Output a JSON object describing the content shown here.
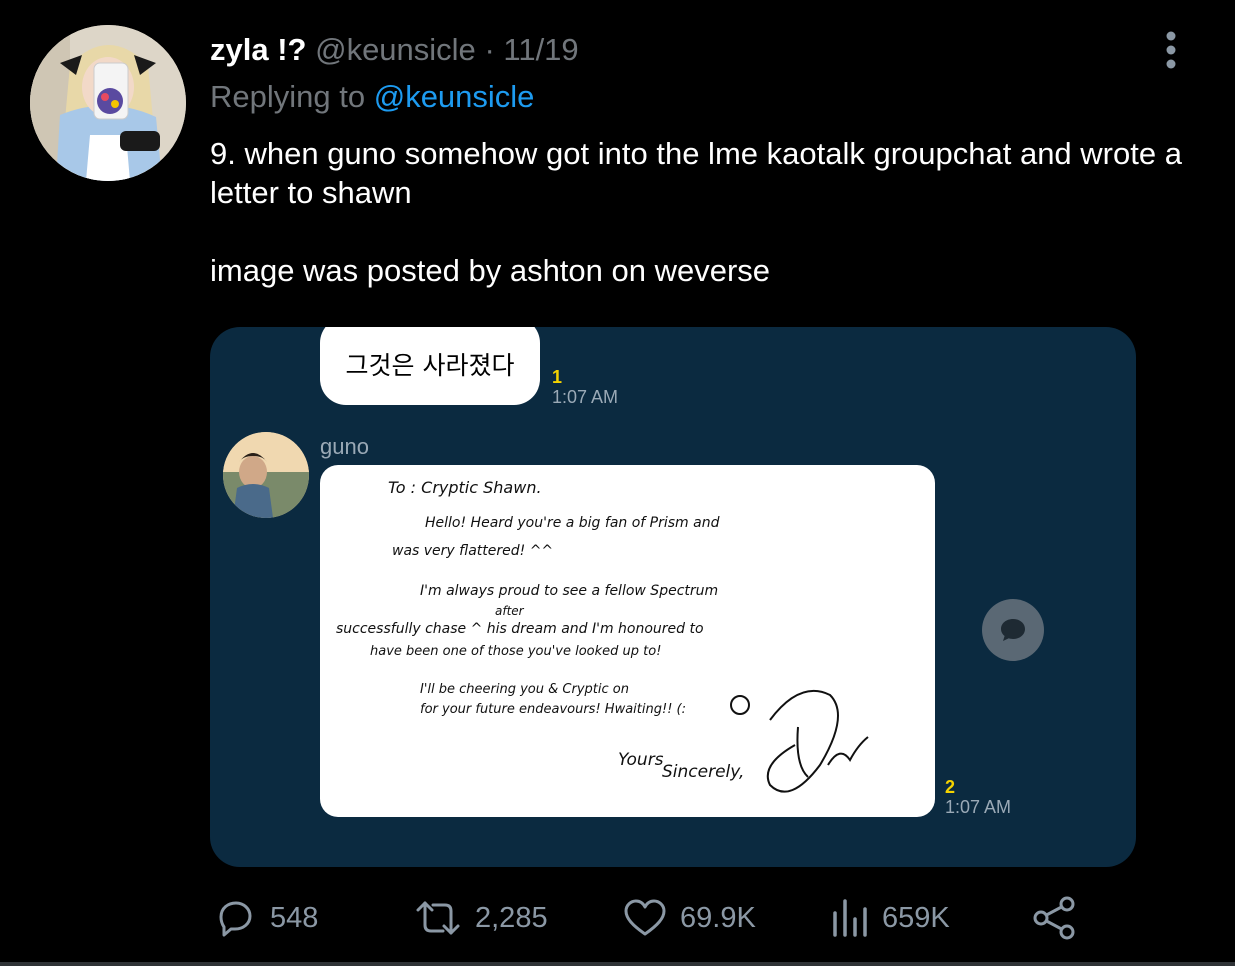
{
  "tweet": {
    "display_name": "zyla !?",
    "handle": "@keunsicle",
    "separator": "·",
    "date": "11/19",
    "replying_prefix": "Replying to ",
    "replying_to": "@keunsicle",
    "text_line1": "9. when guno somehow got into the lme kaotalk groupchat and wrote a letter to shawn",
    "text_line2": "image was posted by ashton on weverse"
  },
  "chat": {
    "top_bubble_text": "그것은 사라졌다",
    "top_unread": "1",
    "top_time": "1:07 AM",
    "sender_name": "guno",
    "letter_unread": "2",
    "letter_time": "1:07 AM",
    "letter": {
      "line1": "To : Cryptic Shawn.",
      "line2": "Hello! Heard you're a big fan of Prism and",
      "line3": "was very flattered! ^^",
      "line4": "I'm always proud to see a fellow Spectrum",
      "line4b": "after",
      "line5": "successfully chase ^ his dream and I'm honoured to",
      "line6": "have been one of those you've looked up to!",
      "line7": "I'll be cheering you & Cryptic on",
      "line8": "for your future endeavours! Hwaiting!! (:",
      "sign_yours": "Yours",
      "sign_sincerely": "Sincerely,"
    }
  },
  "actions": {
    "replies": "548",
    "retweets": "2,285",
    "likes": "69.9K",
    "views": "659K"
  },
  "icons": {
    "more": "more-vertical-icon",
    "reply": "reply-icon",
    "retweet": "retweet-icon",
    "like": "heart-icon",
    "views": "views-icon",
    "share": "share-icon",
    "chat": "chat-bubble-icon"
  },
  "colors": {
    "background": "#000000",
    "link": "#1d9bf0",
    "muted": "#71767b",
    "chat_bg": "#0b2a40",
    "unread": "#f5d300"
  }
}
